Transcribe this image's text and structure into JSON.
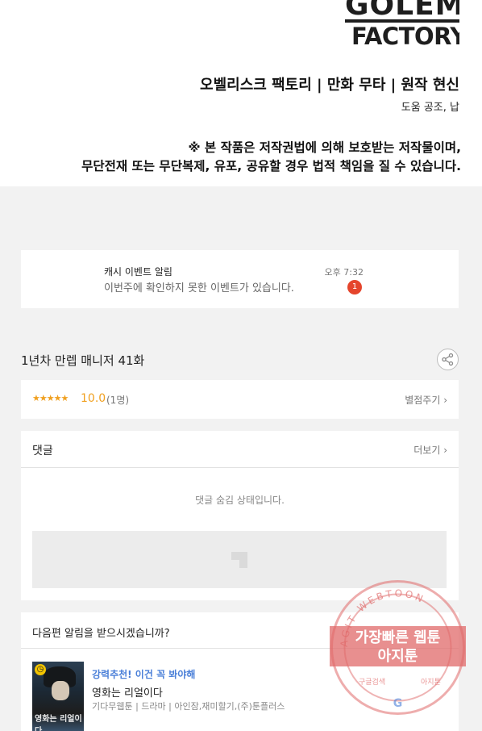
{
  "logo": {
    "line1": "GOLEM",
    "line2": "FACTORY"
  },
  "credits": {
    "main": "오벨리스크 팩토리 | 만화 무타 | 원작 현신",
    "assist": "도움 공조, 납"
  },
  "notice": {
    "line1": "※ 본 작품은 저작권법에 의해 보호받는 저작물이며,",
    "line2": "무단전재 또는 무단복제, 유포, 공유할 경우 법적 책임을 질 수 있습니다."
  },
  "notification": {
    "title": "캐시 이벤트 알림",
    "message": "이번주에 확인하지 못한 이벤트가 있습니다.",
    "time": "오후 7:32",
    "badge": "1"
  },
  "episode": {
    "title": "1년차 만렙 매니저 41화"
  },
  "rating": {
    "stars": "★★★★★",
    "score": "10.0",
    "count": "(1명)",
    "rate_label": "별점주기 ›"
  },
  "comments": {
    "header": "댓글",
    "more": "더보기 ›",
    "hidden_message": "댓글 숨김 상태입니다."
  },
  "next_alert": {
    "question": "다음편 알림을 받으시겠습니까?",
    "recommend_label": "강력추천! 이건 꼭 봐야해",
    "webtoon_title": "영화는 리얼이다",
    "meta": "기다무웹툰 | 드라마 | 아인잠,재미할기,(주)툰플러스",
    "thumb_text": "영화는 리얼이다"
  },
  "watermark": {
    "arc": "AGIT WEBTOON",
    "line1": "가장빠른 웹툰",
    "line2": "아지툰",
    "bottom_left": "구글검색",
    "bottom_right": "아지툰",
    "g": "G"
  },
  "colors": {
    "accent": "#f0a020",
    "badge": "#e5452c",
    "link": "#4a7fd8",
    "watermark": "#e06a6a"
  }
}
